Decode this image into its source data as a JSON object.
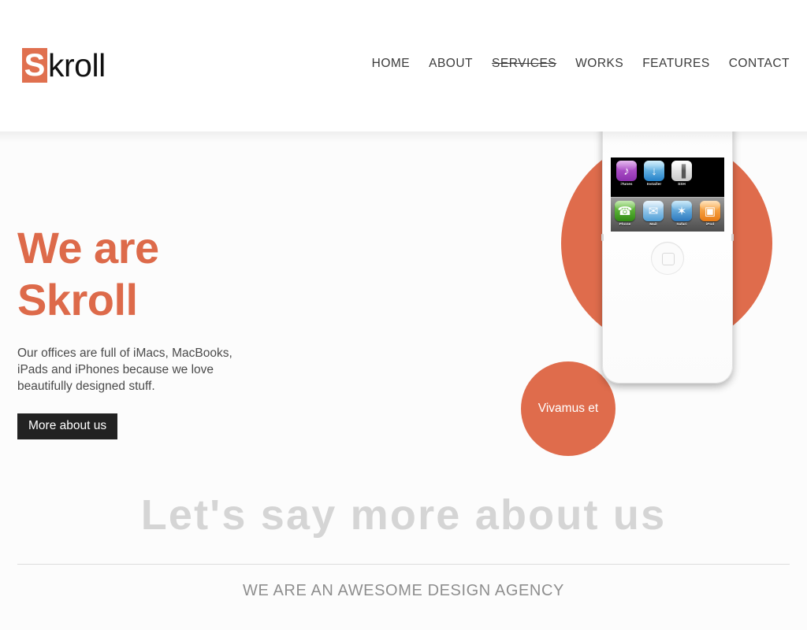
{
  "header": {
    "logo": {
      "mark": "S",
      "word": "kroll",
      "mark_bg": "#e0704f"
    },
    "nav": [
      {
        "label": "HOME",
        "active": false
      },
      {
        "label": "ABOUT",
        "active": false
      },
      {
        "label": "SERVICES",
        "active": true
      },
      {
        "label": "WORKS",
        "active": false
      },
      {
        "label": "FEATURES",
        "active": false
      },
      {
        "label": "CONTACT",
        "active": false
      }
    ]
  },
  "hero": {
    "title_line1": "We are",
    "title_line2": "Skroll",
    "title_color": "#dd6a4a",
    "paragraph": "Our offices are full of iMacs, MacBooks, iPads and iPhones because we love beautifully designed stuff.",
    "button_label": "More about us",
    "button_bg": "#222222",
    "badge_label": "Vivamus et",
    "circle_color": "#df6c4c"
  },
  "device": {
    "apps": [
      {
        "label": "iTunes",
        "icon": "itunes-icon",
        "glyph": "♪"
      },
      {
        "label": "Installer",
        "icon": "installer-icon",
        "glyph": "↓"
      },
      {
        "label": "SSH",
        "icon": "ssh-icon",
        "glyph": "▐"
      }
    ],
    "dock": [
      {
        "label": "Phone",
        "icon": "phone-icon",
        "glyph": "☎"
      },
      {
        "label": "Mail",
        "icon": "mail-icon",
        "glyph": "✉"
      },
      {
        "label": "Safari",
        "icon": "safari-icon",
        "glyph": "✶"
      },
      {
        "label": "iPod",
        "icon": "ipod-icon",
        "glyph": "▣"
      }
    ]
  },
  "about": {
    "title": "Let's say more about us",
    "subtitle": "WE ARE AN AWESOME DESIGN AGENCY"
  }
}
